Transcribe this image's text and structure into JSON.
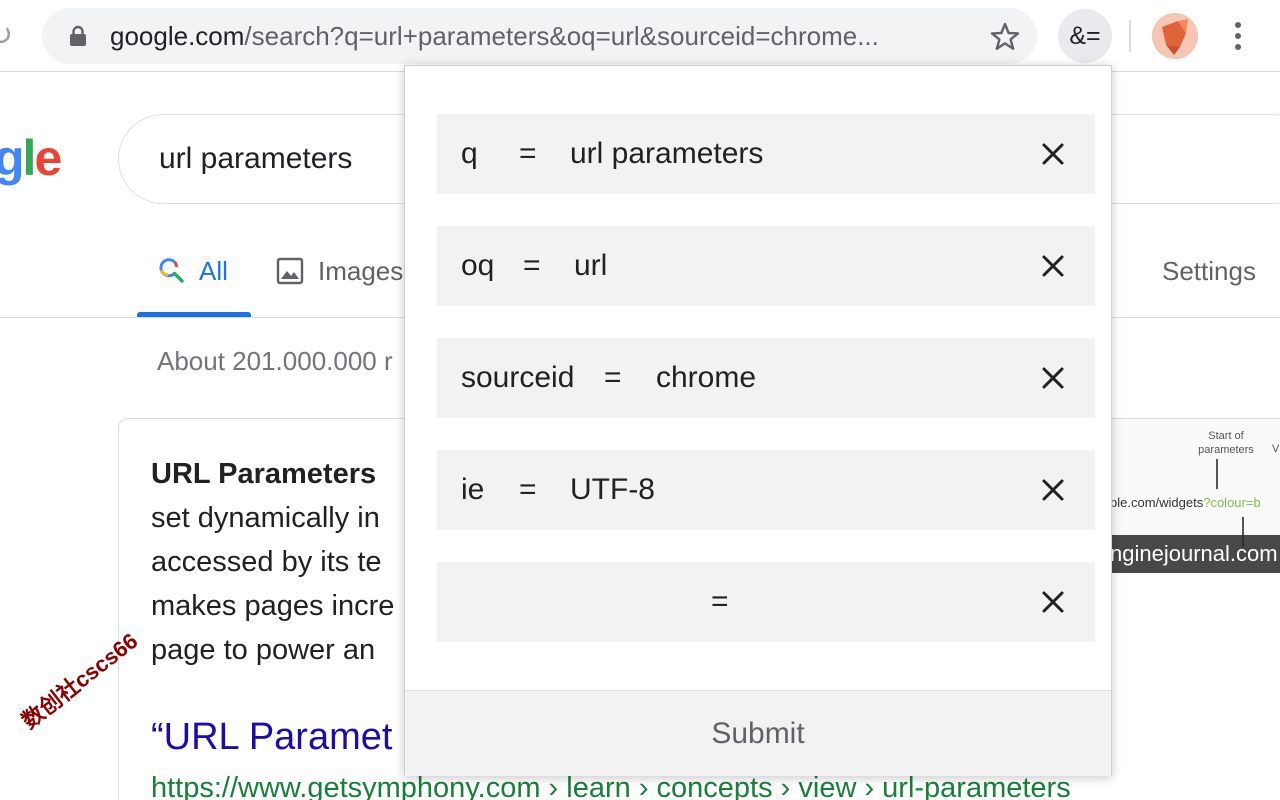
{
  "browser": {
    "url_domain": "google.com",
    "url_path": "/search?q=url+parameters&oq=url&sourceid=chrome...",
    "extension_label": "&="
  },
  "google": {
    "logo_fragment": {
      "g": "g",
      "l": "l",
      "e": "e"
    },
    "search_query": "url parameters",
    "tabs": {
      "all": "All",
      "images": "Images",
      "settings": "Settings"
    },
    "result_stats": "About 201.000.000 r",
    "snippet": {
      "title": "URL Parameters",
      "lines": [
        "set dynamically in",
        "accessed by its te",
        "makes pages incre",
        "page to power an"
      ]
    },
    "snippet_image": {
      "start_label": "Start of parameters",
      "v_label": "V",
      "url_left": "ple.com/widgets",
      "url_param": "?colour=b",
      "caption": "nginejournal.com"
    },
    "result_title": "“URL Paramet",
    "result_url": "https://www.getsymphony.com › learn › concepts › view › url-parameters",
    "watermark": "数创社cscs66"
  },
  "popup": {
    "equals_sign": "=",
    "params": [
      {
        "key": "q",
        "value": "url parameters"
      },
      {
        "key": "oq",
        "value": "url"
      },
      {
        "key": "sourceid",
        "value": "chrome"
      },
      {
        "key": "ie",
        "value": "UTF-8"
      },
      {
        "key": "",
        "value": ""
      }
    ],
    "submit_label": "Submit"
  },
  "colors": {
    "accent_blue": "#1a73e8",
    "link_blue": "#1a0dab",
    "url_green": "#188038",
    "row_bg": "#f2f2f2"
  }
}
